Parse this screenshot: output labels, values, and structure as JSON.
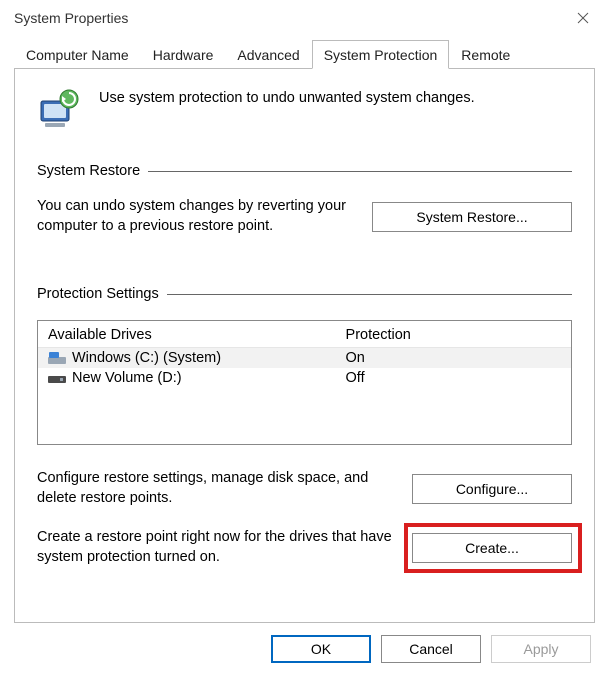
{
  "window": {
    "title": "System Properties"
  },
  "tabs": [
    {
      "label": "Computer Name"
    },
    {
      "label": "Hardware"
    },
    {
      "label": "Advanced"
    },
    {
      "label": "System Protection"
    },
    {
      "label": "Remote"
    }
  ],
  "intro": "Use system protection to undo unwanted system changes.",
  "sections": {
    "restore": {
      "title": "System Restore",
      "text": "You can undo system changes by reverting your computer to a previous restore point.",
      "button": "System Restore..."
    },
    "protection": {
      "title": "Protection Settings",
      "columns": [
        "Available Drives",
        "Protection"
      ],
      "drives": [
        {
          "name": "Windows (C:) (System)",
          "protection": "On"
        },
        {
          "name": "New Volume (D:)",
          "protection": "Off"
        }
      ],
      "configure": {
        "text": "Configure restore settings, manage disk space, and delete restore points.",
        "button": "Configure..."
      },
      "create": {
        "text": "Create a restore point right now for the drives that have system protection turned on.",
        "button": "Create..."
      }
    }
  },
  "footer": {
    "ok": "OK",
    "cancel": "Cancel",
    "apply": "Apply"
  }
}
